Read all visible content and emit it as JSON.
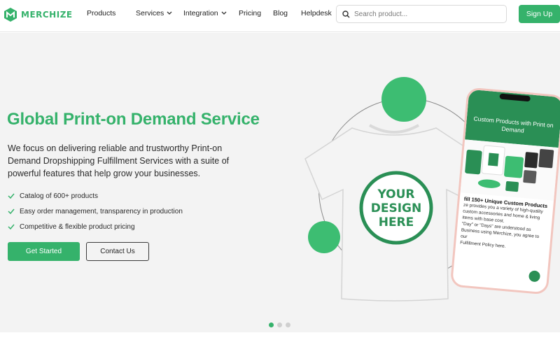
{
  "brand": {
    "name": "MERCHIZE",
    "accent": "#35b26b"
  },
  "nav": {
    "items": [
      {
        "label": "Products",
        "dropdown": false
      },
      {
        "label": "Services",
        "dropdown": true
      },
      {
        "label": "Integration",
        "dropdown": true
      },
      {
        "label": "Pricing",
        "dropdown": false
      },
      {
        "label": "Blog",
        "dropdown": false
      },
      {
        "label": "Helpdesk",
        "dropdown": false
      }
    ],
    "search_placeholder": "Search product...",
    "signup_label": "Sign Up"
  },
  "hero": {
    "title": "Global Print-on Demand Service",
    "description": "We focus on delivering reliable and trustworthy Print-on Demand Dropshipping Fulfillment Services with a suite of powerful features that help grow your businesses.",
    "features": [
      "Catalog of 600+ products",
      "Easy order management, transparency in production",
      "Competitive & flexible product pricing"
    ],
    "primary_button": "Get Started",
    "secondary_button": "Contact Us"
  },
  "artwork": {
    "tshirt_print": [
      "YOUR",
      "DESIGN",
      "HERE"
    ],
    "phone_header": "Custom Products with Print on Demand",
    "phone_heading": "fill 150+ Unique Custom Products",
    "phone_body": "ze provides you a variety of high-quality custom accessories and home & living items with base cost.",
    "phone_body2": "\"Day\" or \"Days\" are understood as Business using Merchize, you agree to our",
    "phone_body3": "Fulfillment Policy here."
  },
  "carousel": {
    "count": 3,
    "active_index": 0
  }
}
